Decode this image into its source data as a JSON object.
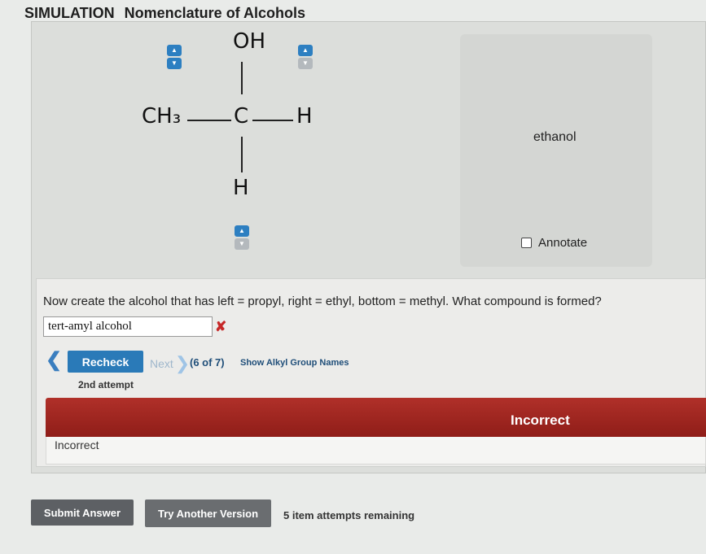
{
  "header": {
    "section": "SIMULATION",
    "title": "Nomenclature of Alcohols"
  },
  "molecule": {
    "top_group": "OH",
    "left_group": "CH₃",
    "center_atom": "C",
    "right_group": "H",
    "bottom_group": "H"
  },
  "name_panel": {
    "name": "ethanol",
    "annotate_label": "Annotate"
  },
  "question": {
    "text": "Now create the alcohol that has left = propyl, right = ethyl, bottom = methyl. What compound is formed?",
    "answer_value": "tert-amyl alcohol",
    "wrong_mark": "✘"
  },
  "controls": {
    "prev_glyph": "❮",
    "recheck_label": "Recheck",
    "next_label": "Next",
    "next_glyph": "❯",
    "counter": "(6 of 7)",
    "show_alkyl_label": "Show Alkyl Group Names",
    "attempt_label": "2nd attempt"
  },
  "feedback": {
    "title": "Incorrect",
    "body": "Incorrect"
  },
  "footer": {
    "submit_label": "Submit Answer",
    "try_another_label": "Try Another Version",
    "remaining_label": "5 item attempts remaining"
  },
  "colors": {
    "accent": "#2a7ab8",
    "error": "#b03029",
    "disabled_spinner": "#b4b9bd"
  }
}
